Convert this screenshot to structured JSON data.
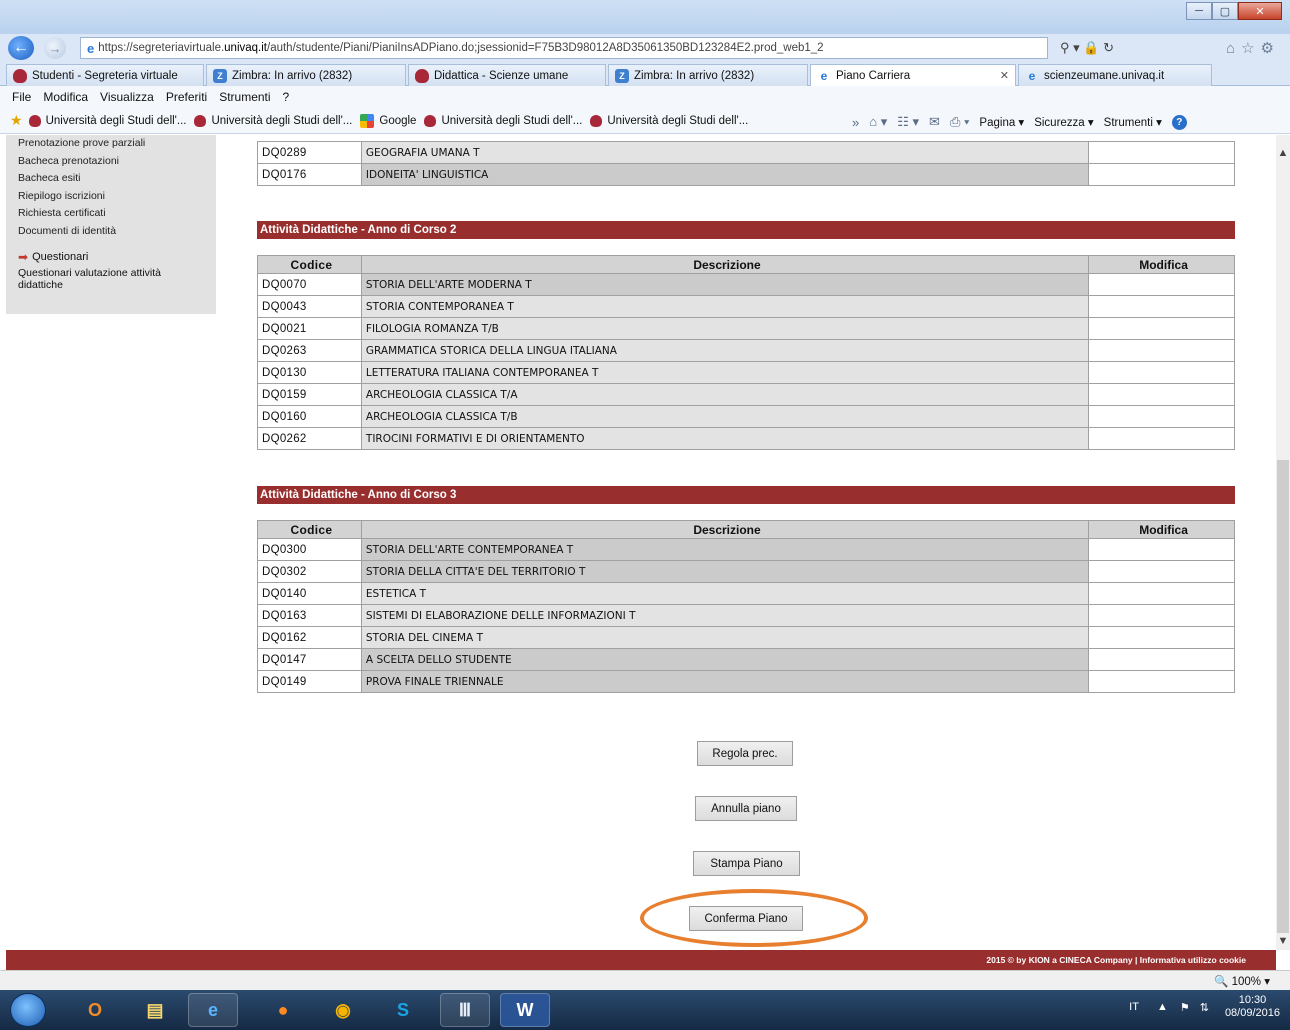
{
  "browser": {
    "url_prefix": "https://segreteriavirtuale.",
    "url_domain": "univaq.it",
    "url_suffix": "/auth/studente/Piani/PianiInsADPiano.do;jsessionid=F75B3D98012A8D35061350BD123284E2.prod_web1_2",
    "tabs": [
      {
        "label": "Studenti - Segreteria virtuale",
        "icon": "shield-icon"
      },
      {
        "label": "Zimbra: In arrivo (2832)",
        "icon": "zimbra-icon"
      },
      {
        "label": "Didattica - Scienze umane",
        "icon": "shield-icon"
      },
      {
        "label": "Zimbra: In arrivo (2832)",
        "icon": "zimbra-icon"
      },
      {
        "label": "Piano Carriera",
        "icon": "ie-icon",
        "active": true
      },
      {
        "label": "scienzeumane.univaq.it",
        "icon": "ie-icon"
      }
    ],
    "menu": [
      "File",
      "Modifica",
      "Visualizza",
      "Preferiti",
      "Strumenti",
      "?"
    ],
    "favorites": [
      {
        "label": "Università degli Studi dell'...",
        "icon": "shield-icon"
      },
      {
        "label": "Università degli Studi dell'...",
        "icon": "shield-icon"
      },
      {
        "label": "Google",
        "icon": "google-icon"
      },
      {
        "label": "Università degli Studi dell'...",
        "icon": "shield-icon"
      },
      {
        "label": "Università degli Studi dell'...",
        "icon": "shield-icon"
      }
    ],
    "command_bar": {
      "pagina": "Pagina ▾",
      "sicurezza": "Sicurezza ▾",
      "strumenti": "Strumenti ▾"
    },
    "zoom": "100%"
  },
  "sidebar": {
    "links": [
      "Prenotazione prove parziali",
      "Bacheca prenotazioni",
      "Bacheca esiti",
      "Riepilogo iscrizioni",
      "Richiesta certificati",
      "Documenti di identità"
    ],
    "section_title": "Questionari",
    "section_link": "Questionari valutazione attività didattiche"
  },
  "table_headers": {
    "code": "Codice",
    "description": "Descrizione",
    "modify": "Modifica"
  },
  "year1_tail": [
    {
      "code": "DQ0289",
      "desc": "GEOGRAFIA UMANA T",
      "dark": false
    },
    {
      "code": "DQ0176",
      "desc": "IDONEITA' LINGUISTICA",
      "dark": true
    }
  ],
  "year2": {
    "title": "Attività Didattiche - Anno di Corso 2",
    "rows": [
      {
        "code": "DQ0070",
        "desc": "STORIA DELL'ARTE MODERNA T",
        "dark": true
      },
      {
        "code": "DQ0043",
        "desc": "STORIA CONTEMPORANEA T",
        "dark": false
      },
      {
        "code": "DQ0021",
        "desc": "FILOLOGIA ROMANZA T/B",
        "dark": false
      },
      {
        "code": "DQ0263",
        "desc": "GRAMMATICA STORICA DELLA LINGUA ITALIANA",
        "dark": false
      },
      {
        "code": "DQ0130",
        "desc": "LETTERATURA ITALIANA CONTEMPORANEA T",
        "dark": false
      },
      {
        "code": "DQ0159",
        "desc": "ARCHEOLOGIA CLASSICA T/A",
        "dark": false
      },
      {
        "code": "DQ0160",
        "desc": "ARCHEOLOGIA CLASSICA T/B",
        "dark": false
      },
      {
        "code": "DQ0262",
        "desc": "TIROCINI FORMATIVI E DI ORIENTAMENTO",
        "dark": false
      }
    ]
  },
  "year3": {
    "title": "Attività Didattiche - Anno di Corso 3",
    "rows": [
      {
        "code": "DQ0300",
        "desc": "STORIA DELL'ARTE CONTEMPORANEA T",
        "dark": true
      },
      {
        "code": "DQ0302",
        "desc": "STORIA DELLA CITTA'E DEL TERRITORIO T",
        "dark": true
      },
      {
        "code": "DQ0140",
        "desc": "ESTETICA T",
        "dark": false
      },
      {
        "code": "DQ0163",
        "desc": "SISTEMI DI ELABORAZIONE DELLE INFORMAZIONI T",
        "dark": false
      },
      {
        "code": "DQ0162",
        "desc": "STORIA DEL CINEMA T",
        "dark": false
      },
      {
        "code": "DQ0147",
        "desc": "A SCELTA DELLO STUDENTE",
        "dark": true
      },
      {
        "code": "DQ0149",
        "desc": "PROVA FINALE TRIENNALE",
        "dark": true
      }
    ]
  },
  "buttons": {
    "prev_rule": "Regola prec.",
    "cancel_plan": "Annulla piano",
    "print_plan": "Stampa  Piano",
    "confirm_plan": "Conferma Piano"
  },
  "footer": "2015 © by KION a CINECA Company | Informativa utilizzo cookie",
  "taskbar": {
    "lang": "IT",
    "time": "10:30",
    "date": "08/09/2016"
  },
  "colors": {
    "section_header": "#992e2e",
    "highlight": "#e87f2e"
  }
}
